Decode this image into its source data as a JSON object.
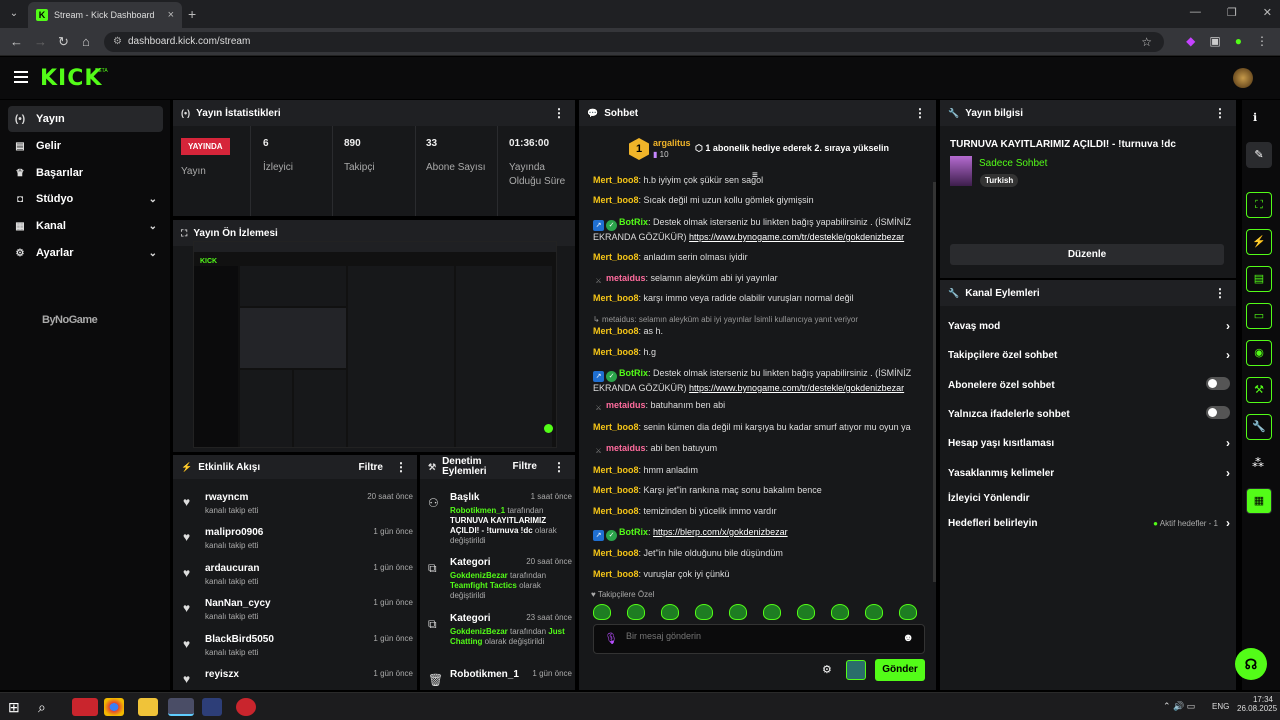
{
  "browser": {
    "tab_title": "Stream - Kick Dashboard",
    "url": "dashboard.kick.com/stream"
  },
  "app": {
    "logo": "KICK",
    "beta": "BETA"
  },
  "sidebar": {
    "items": [
      {
        "label": "Yayın"
      },
      {
        "label": "Gelir"
      },
      {
        "label": "Başarılar"
      },
      {
        "label": "Stüdyo"
      },
      {
        "label": "Kanal"
      },
      {
        "label": "Ayarlar"
      }
    ],
    "sponsor": "ByNoGame"
  },
  "stats": {
    "title": "Yayın İstatistikleri",
    "live": "YAYINDA",
    "live_label": "Yayın",
    "items": [
      {
        "value": "6",
        "label": "İzleyici"
      },
      {
        "value": "890",
        "label": "Takipçi"
      },
      {
        "value": "33",
        "label": "Abone Sayısı"
      },
      {
        "value": "01:36:00",
        "label": "Yayında Olduğu Süre"
      }
    ]
  },
  "preview": {
    "title": "Yayın Ön İzlemesi"
  },
  "activity": {
    "title": "Etkinlik Akışı",
    "filter": "Filtre",
    "items": [
      {
        "name": "rwayncm",
        "sub": "kanalı takip etti",
        "time": "20 saat önce"
      },
      {
        "name": "malipro0906",
        "sub": "kanalı takip etti",
        "time": "1 gün önce"
      },
      {
        "name": "ardaucuran",
        "sub": "kanalı takip etti",
        "time": "1 gün önce"
      },
      {
        "name": "NanNan_cycy",
        "sub": "kanalı takip etti",
        "time": "1 gün önce"
      },
      {
        "name": "BlackBird5050",
        "sub": "kanalı takip etti",
        "time": "1 gün önce"
      },
      {
        "name": "reyiszx",
        "sub": "",
        "time": "1 gün önce"
      }
    ]
  },
  "moderation": {
    "title": "Denetim Eylemleri",
    "filter": "Filtre",
    "items": [
      {
        "head": "Başlık",
        "time": "1 saat önce",
        "user": "Robotikmen_1",
        "by": "tarafından",
        "value": "TURNUVA KAYITLARIMIZ AÇILDI! - !turnuva !dc",
        "suffix": "olarak değiştirildi"
      },
      {
        "head": "Kategori",
        "time": "20 saat önce",
        "user": "GokdenizBezar",
        "by": "tarafından",
        "value": "Teamfight Tactics",
        "suffix": "olarak değiştirildi"
      },
      {
        "head": "Kategori",
        "time": "23 saat önce",
        "user": "GokdenizBezar",
        "by": "tarafından",
        "value": "Just Chatting",
        "suffix": "olarak değiştirildi"
      },
      {
        "head": "Robotikmen_1",
        "time": "1 gün önce",
        "user": "",
        "by": "",
        "value": "",
        "suffix": ""
      }
    ]
  },
  "chat": {
    "title": "Sohbet",
    "pinned_user": "argalitus",
    "pinned_count": "10",
    "pinned_rank": "1",
    "pinned_text": "1 abonelik hediye ederek 2. sıraya yükselin",
    "messages": [
      {
        "user": "Mert_boo8",
        "color": "#f5c518",
        "text": "h.b iyiyim çok şükür sen sagol"
      },
      {
        "user": "Mert_boo8",
        "color": "#f5c518",
        "text": "Sıcak değil mi uzun kollu gömlek giymişsin"
      },
      {
        "user": "BotRix",
        "color": "#53fc18",
        "text": "Destek olmak isterseniz bu linkten bağış yapabilirsiniz . (İSMİNİZ EKRANDA GÖZÜKÜR)",
        "link": "https://www.bynogame.com/tr/destekle/gokdenizbezar"
      },
      {
        "user": "Mert_boo8",
        "color": "#f5c518",
        "text": "anladım serin olması iyidir"
      },
      {
        "user": "metaidus",
        "color": "#ff6b9d",
        "text": "selamın aleyküm abi iyi yayınlar"
      },
      {
        "user": "Mert_boo8",
        "color": "#f5c518",
        "text": "karşı immo veya radide olabilir vuruşları normal değil"
      },
      {
        "reply": "metaidus: selamın aleyküm abi iyi yayınlar İsimli kullanıcıya yanıt veriyor"
      },
      {
        "user": "Mert_boo8",
        "color": "#f5c518",
        "text": "as h."
      },
      {
        "user": "Mert_boo8",
        "color": "#f5c518",
        "text": "h.g"
      },
      {
        "user": "BotRix",
        "color": "#53fc18",
        "text": "Destek olmak isterseniz bu linkten bağış yapabilirsiniz . (İSMİNİZ EKRANDA GÖZÜKÜR)",
        "link": "https://www.bynogame.com/tr/destekle/gokdenizbezar"
      },
      {
        "user": "metaidus",
        "color": "#ff6b9d",
        "text": "batuhanım ben abi"
      },
      {
        "user": "Mert_boo8",
        "color": "#f5c518",
        "text": "senin kümen dia değil mi karşıya bu kadar smurf atıyor mu oyun ya"
      },
      {
        "user": "metaidus",
        "color": "#ff6b9d",
        "text": "abi ben batuyum"
      },
      {
        "user": "Mert_boo8",
        "color": "#f5c518",
        "text": "hmm anladım"
      },
      {
        "user": "Mert_boo8",
        "color": "#f5c518",
        "text": "Karşı jet\"in rankına maç sonu bakalım bence"
      },
      {
        "user": "Mert_boo8",
        "color": "#f5c518",
        "text": "temizinden bi yücelik immo vardır"
      },
      {
        "user": "BotRix",
        "color": "#53fc18",
        "text": "",
        "link": "https://blerp.com/x/gokdenizbezar"
      },
      {
        "user": "Mert_boo8",
        "color": "#f5c518",
        "text": "Jet\"in hile olduğunu bile düşündüm"
      },
      {
        "user": "Mert_boo8",
        "color": "#f5c518",
        "text": "vuruşlar çok iyi çünkü"
      }
    ],
    "followers_only": "Takipçilere Özel",
    "placeholder": "Bir mesaj gönderin",
    "send": "Gönder"
  },
  "info": {
    "title": "Yayın bilgisi",
    "stream_title": "TURNUVA KAYITLARIMIZ AÇILDI! - !turnuva !dc",
    "category": "Sadece Sohbet",
    "tag": "Turkish",
    "edit": "Düzenle"
  },
  "channel_actions": {
    "title": "Kanal Eylemleri",
    "items": [
      {
        "label": "Yavaş mod",
        "type": "arrow"
      },
      {
        "label": "Takipçilere özel sohbet",
        "type": "arrow"
      },
      {
        "label": "Abonelere özel sohbet",
        "type": "toggle"
      },
      {
        "label": "Yalnızca ifadelerle sohbet",
        "type": "toggle"
      },
      {
        "label": "Hesap yaşı kısıtlaması",
        "type": "arrow"
      },
      {
        "label": "Yasaklanmış kelimeler",
        "type": "arrow"
      },
      {
        "label": "İzleyici Yönlendir",
        "type": "none"
      },
      {
        "label": "Hedefleri belirleyin",
        "type": "arrow"
      }
    ],
    "goal_status": "Aktif hedefler - 1"
  },
  "taskbar": {
    "lang": "ENG",
    "time": "17:34",
    "date": "26.08.2025"
  }
}
